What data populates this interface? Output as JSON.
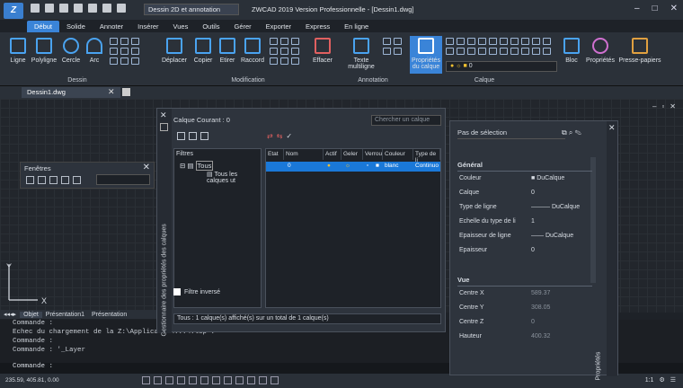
{
  "app": {
    "window_title": "ZWCAD 2019 Version Professionnelle - [Dessin1.dwg]",
    "workspace": "Dessin 2D et annotation"
  },
  "tabs": [
    "Début",
    "Solide",
    "Annoter",
    "Insérer",
    "Vues",
    "Outils",
    "Gérer",
    "Exporter",
    "Express",
    "En ligne"
  ],
  "ribbon": {
    "draw": {
      "label": "Dessin",
      "buttons": [
        "Ligne",
        "Polyligne",
        "Cercle",
        "Arc"
      ]
    },
    "modify": {
      "label": "Modification",
      "buttons": [
        "Déplacer",
        "Copier",
        "Etirer",
        "Raccord",
        "Effacer"
      ]
    },
    "annotation": {
      "label": "Annotation",
      "text_label": "Texte multiligne"
    },
    "layer": {
      "label": "Calque",
      "props_label": "Propriétés du calque",
      "current_layer": "0"
    },
    "block_label": "Bloc",
    "properties_label": "Propriétés",
    "clipboard_label": "Presse-papiers"
  },
  "document": {
    "tab": "Dessin1.dwg"
  },
  "fenetres": {
    "title": "Fenêtres"
  },
  "layout_tabs": [
    "Objet",
    "Présentation1",
    "Présentation"
  ],
  "command": {
    "lines": [
      "Commande :",
      "Echec du chargement de la Z:\\Applicatio\\...\\.lsp .",
      "Commande :",
      "Commande : '_Layer"
    ],
    "prompt": "Commande :"
  },
  "status": {
    "coords": "235.59, 405.81, 0.00",
    "scale": "1:1"
  },
  "layer_manager": {
    "title": "Gestionnaire des propriétés des calques",
    "current": "Calque Courant : 0",
    "search_placeholder": "Chercher un calque",
    "filters_header": "Filtres",
    "tree_all": "Tous",
    "tree_used": "Tous les calques ut",
    "invert": "Filtre inversé",
    "columns": [
      "Etat",
      "Nom",
      "Actif",
      "Geler",
      "Verrou",
      "Couleur",
      "Type de li"
    ],
    "row": {
      "name": "0",
      "color": "blanc",
      "linetype": "Continuo"
    },
    "status": "Tous : 1 calque(s) affiché(s) sur un total de  1 calque(s)"
  },
  "properties": {
    "title": "Propriétés",
    "selection": "Pas de sélection",
    "general": {
      "label": "Général",
      "rows": [
        [
          "Couleur",
          "DuCalque"
        ],
        [
          "Calque",
          "0"
        ],
        [
          "Type de ligne",
          "DuCalque"
        ],
        [
          "Echelle du type de li",
          "1"
        ],
        [
          "Epaisseur de ligne",
          "DuCalque"
        ],
        [
          "Epaisseur",
          "0"
        ]
      ]
    },
    "view": {
      "label": "Vue",
      "rows": [
        [
          "Centre X",
          "589.37"
        ],
        [
          "Centre Y",
          "308.05"
        ],
        [
          "Centre Z",
          "0"
        ],
        [
          "Hauteur",
          "400.32"
        ]
      ]
    }
  }
}
